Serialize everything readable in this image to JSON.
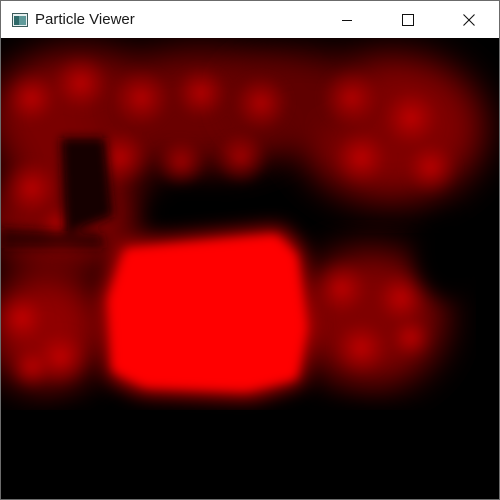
{
  "window": {
    "title": "Particle Viewer"
  },
  "titlebar": {
    "app_icon": "application-window-icon",
    "controls": [
      {
        "name": "minimize",
        "icon": "minimize-icon"
      },
      {
        "name": "maximize",
        "icon": "maximize-icon"
      },
      {
        "name": "close",
        "icon": "close-icon"
      }
    ]
  },
  "viewport": {
    "background_color": "#000000",
    "particle_color": "#ff0000"
  }
}
